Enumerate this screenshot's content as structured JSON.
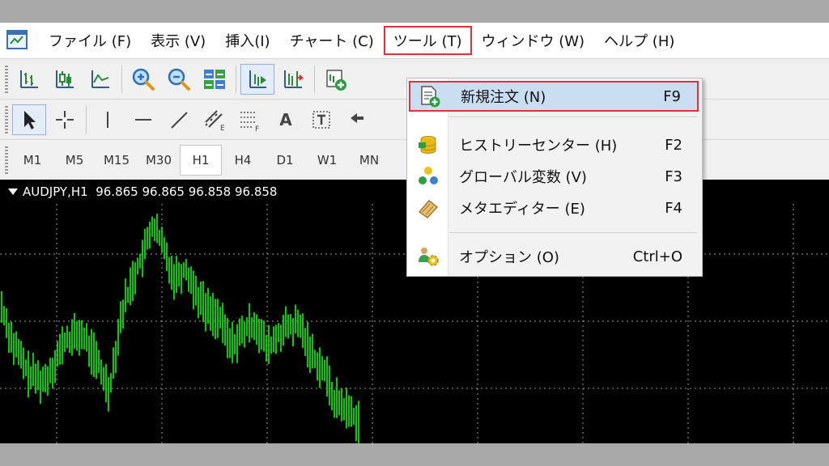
{
  "menubar": {
    "items": [
      {
        "label": "ファイル (F)"
      },
      {
        "label": "表示 (V)"
      },
      {
        "label": "挿入(I)"
      },
      {
        "label": "チャート (C)"
      },
      {
        "label": "ツール (T)"
      },
      {
        "label": "ウィンドウ (W)"
      },
      {
        "label": "ヘルプ (H)"
      }
    ],
    "open_item": "ツール (T)"
  },
  "toolbar3": {
    "timeframes": [
      "M1",
      "M5",
      "M15",
      "M30",
      "H1",
      "H4",
      "D1",
      "W1",
      "MN"
    ],
    "active": "H1"
  },
  "toolbar2": {
    "text_tool_label": "A"
  },
  "chart": {
    "symbol_line": "AUDJPY,H1  96.865 96.865 96.858 96.858",
    "background": "#000000",
    "candle_color": "#00ff00",
    "grid_color": "#9a9a9a"
  },
  "dropdown": {
    "items": [
      {
        "label": "新規注文 (N)",
        "shortcut": "F9",
        "icon": "new-order-icon"
      },
      {
        "label": "ヒストリーセンター (H)",
        "shortcut": "F2",
        "icon": "history-center-icon"
      },
      {
        "label": "グローバル変数 (V)",
        "shortcut": "F3",
        "icon": "global-variables-icon"
      },
      {
        "label": "メタエディター (E)",
        "shortcut": "F4",
        "icon": "meta-editor-icon"
      },
      {
        "label": "オプション (O)",
        "shortcut": "Ctrl+O",
        "icon": "options-icon"
      }
    ]
  },
  "colors": {
    "highlight_outline": "#e0303a",
    "selection_fill": "#c9def1"
  }
}
